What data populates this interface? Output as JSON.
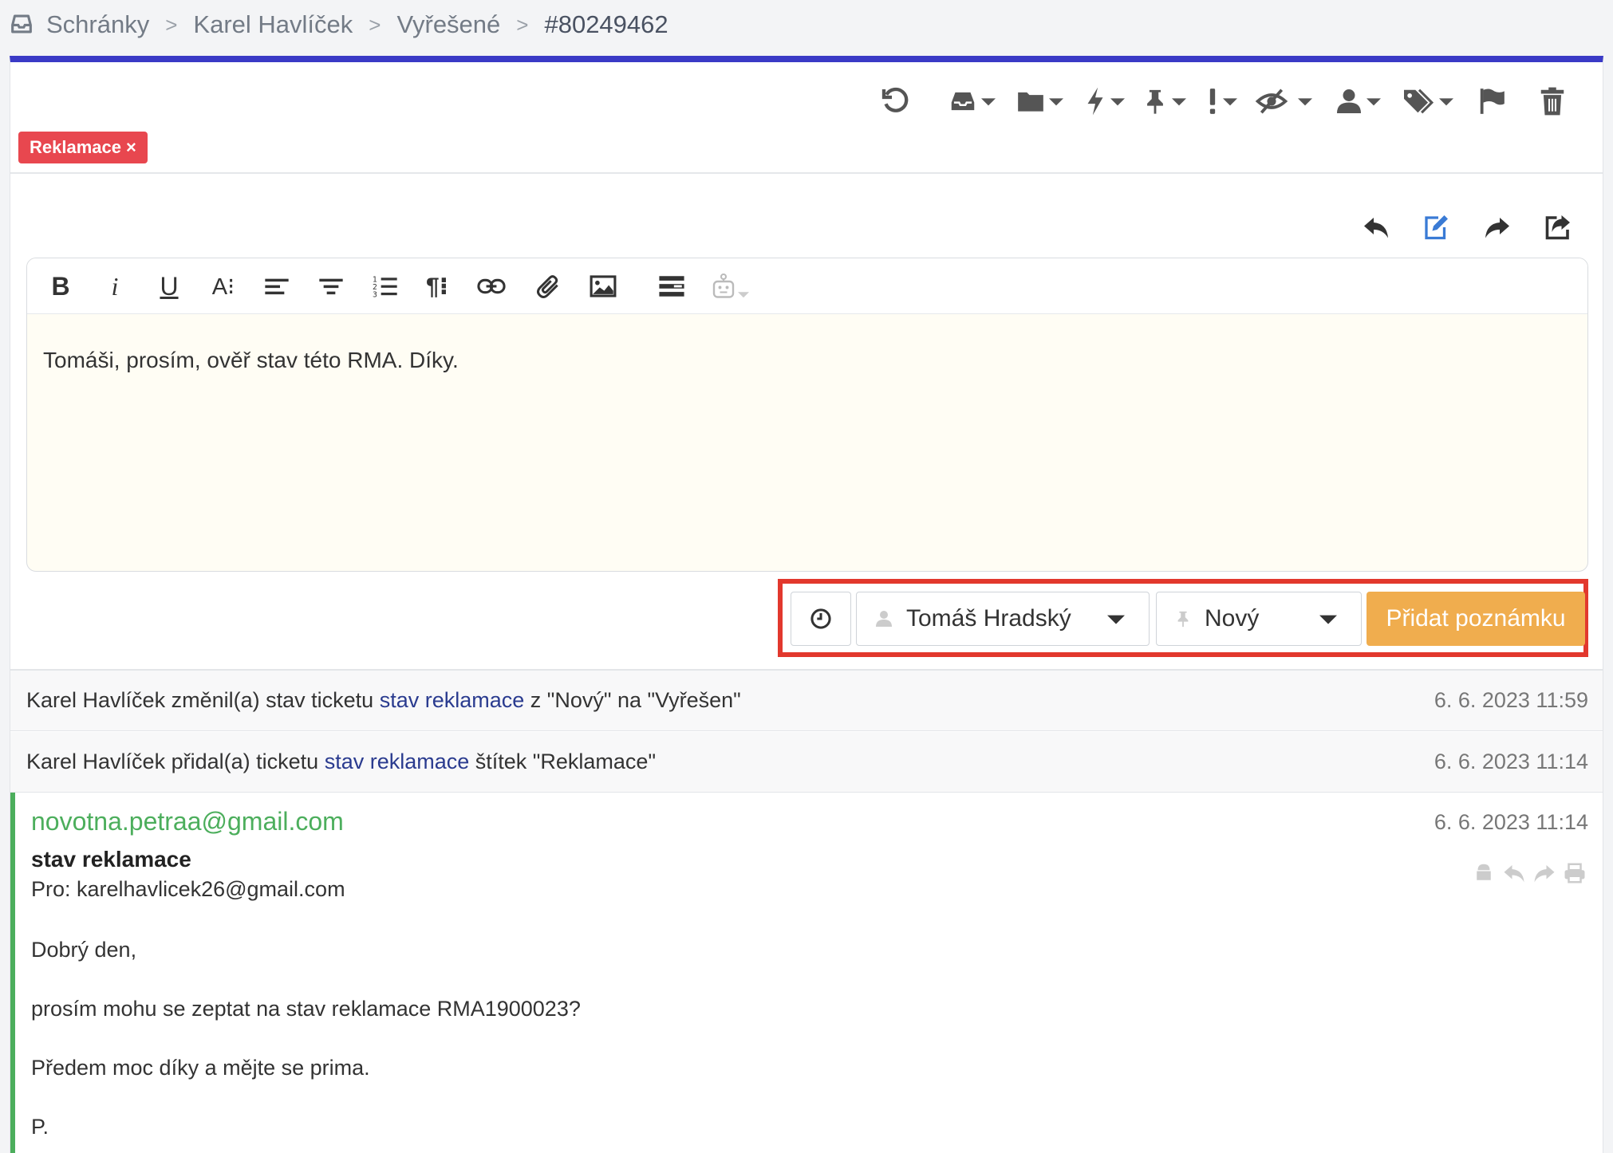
{
  "breadcrumb": {
    "items": [
      "Schránky",
      "Karel Havlíček",
      "Vyřešené"
    ],
    "current": "#80249462",
    "separator": ">"
  },
  "tags": [
    {
      "label": "Reklamace",
      "remove": "×",
      "color": "#e8474f"
    }
  ],
  "editor": {
    "text": "Tomáši, prosím, ověř stav této RMA. Díky.",
    "toolbar": {
      "bold": "B",
      "italic": "i",
      "underline": "U",
      "font_size": "A⁝",
      "paragraph": "¶⁝"
    }
  },
  "note_controls": {
    "assignee": "Tomáš Hradský",
    "status": "Nový",
    "submit_label": "Přidat poznámku"
  },
  "events": [
    {
      "actor": "Karel Havlíček",
      "action": "změnil(a) stav ticketu",
      "ticket": "stav reklamace",
      "detail": "z \"Nový\" na \"Vyřešen\"",
      "date": "6. 6. 2023 11:59"
    },
    {
      "actor": "Karel Havlíček",
      "action": "přidal(a) ticketu",
      "ticket": "stav reklamace",
      "detail": "štítek \"Reklamace\"",
      "date": "6. 6. 2023 11:14"
    }
  ],
  "message": {
    "from": "novotna.petraa@gmail.com",
    "date": "6. 6. 2023 11:14",
    "subject": "stav reklamace",
    "to": "Pro: karelhavlicek26@gmail.com",
    "body": [
      "Dobrý den,",
      "prosím mohu se zeptat na stav reklamace RMA1900023?",
      "Předem moc díky a mějte se prima.",
      "P."
    ]
  },
  "colors": {
    "accent": "#3a3ac6",
    "tag_red": "#e8474f",
    "submit_orange": "#f0ad4e",
    "email_green": "#4cae5c",
    "highlight": "#e2382d",
    "link": "#2a3b8f"
  }
}
